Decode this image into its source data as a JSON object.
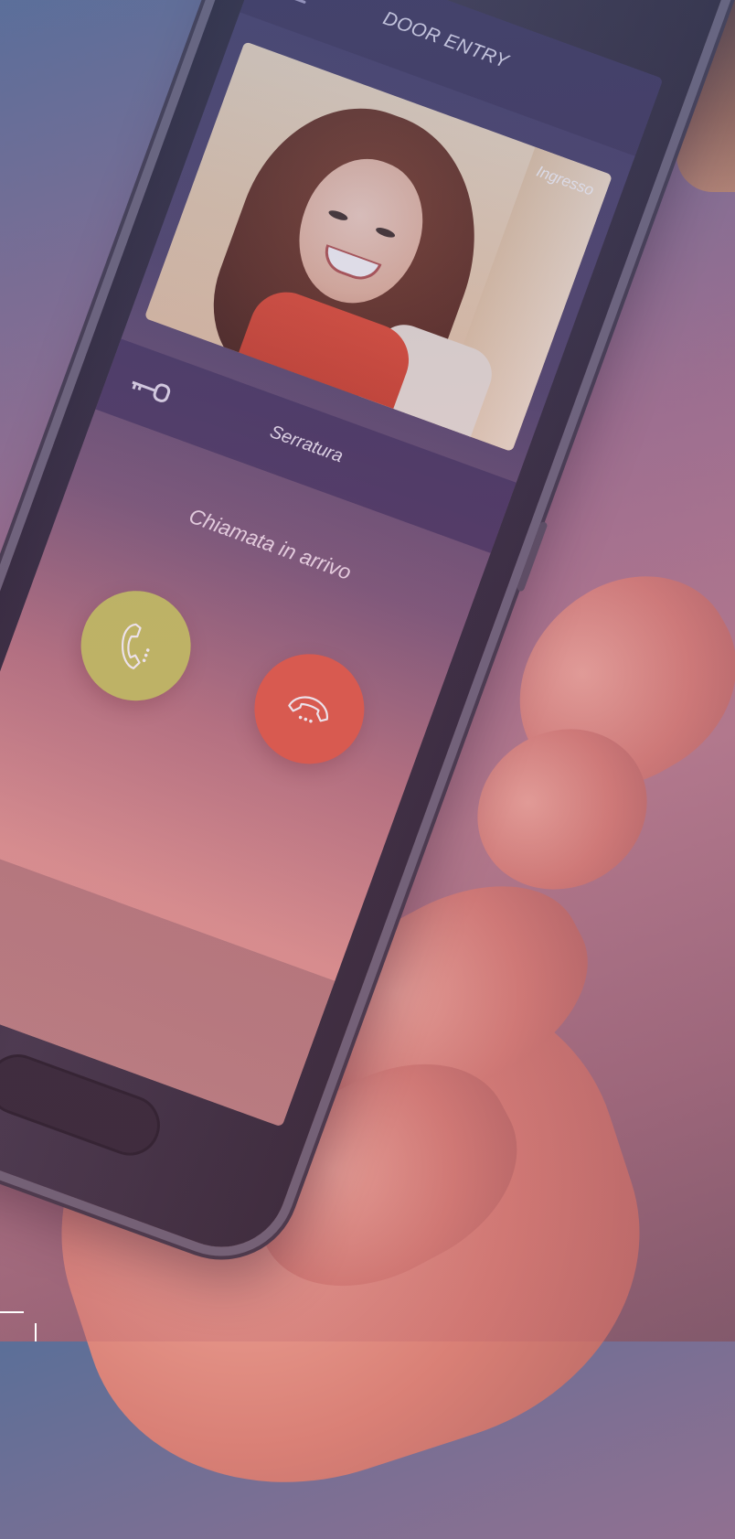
{
  "header": {
    "title": "DOOR ENTRY",
    "menu_icon": "hamburger-menu-icon"
  },
  "video": {
    "label": "Ingresso"
  },
  "lock": {
    "label": "Serratura",
    "icon": "key-icon"
  },
  "call": {
    "status": "Chiamata in arrivo",
    "accept_icon": "phone-answer-icon",
    "decline_icon": "phone-hangup-icon"
  },
  "colors": {
    "header_bg": "#3a3258",
    "accept": "#c6c55e",
    "decline": "#e65a44",
    "lock_row_bg": "#3c2d5a",
    "text": "#f1eaf6"
  }
}
